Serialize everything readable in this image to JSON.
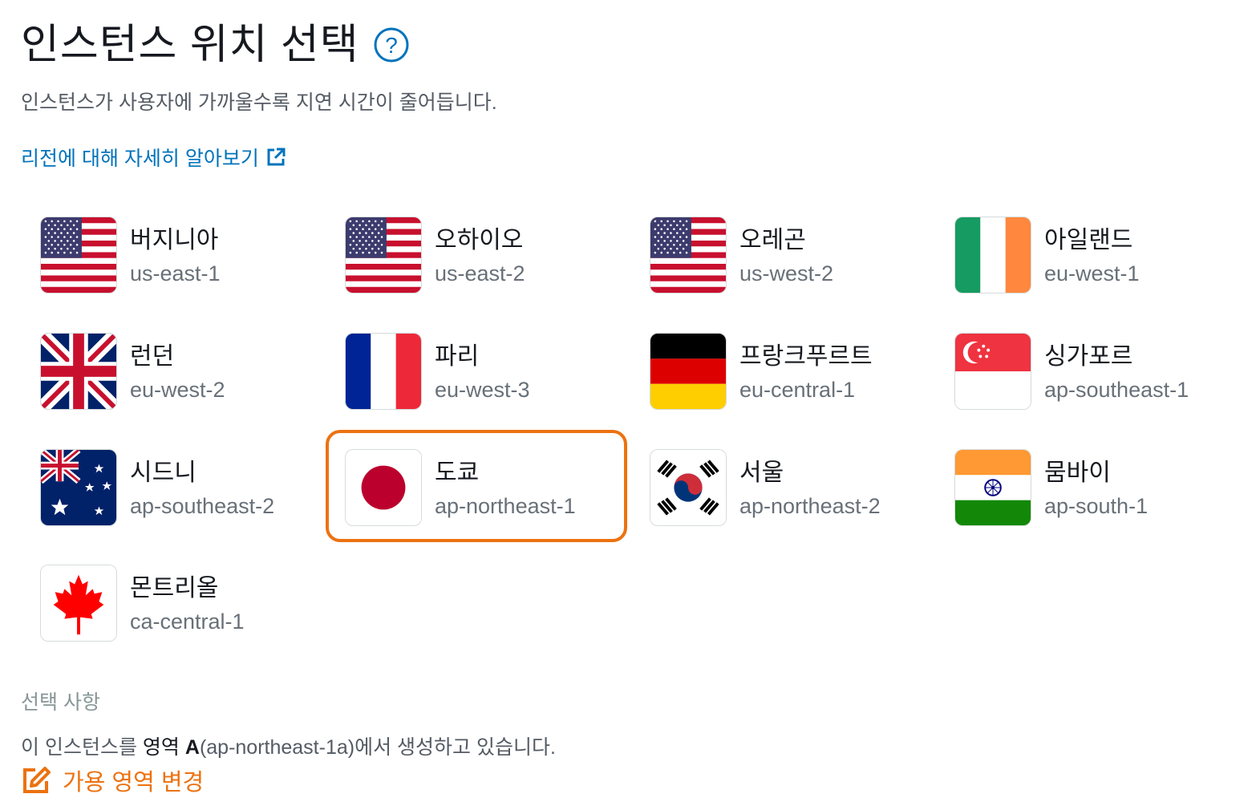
{
  "header": {
    "title": "인스턴스 위치 선택",
    "help_icon": "help-circle-icon",
    "subtitle": "인스턴스가 사용자에 가까울수록 지연 시간이 줄어듭니다.",
    "learn_more_label": "리전에 대해 자세히 알아보기",
    "learn_more_icon": "external-link-icon"
  },
  "regions": [
    {
      "name": "버지니아",
      "code": "us-east-1",
      "flag": "usa-flag"
    },
    {
      "name": "오하이오",
      "code": "us-east-2",
      "flag": "usa-flag"
    },
    {
      "name": "오레곤",
      "code": "us-west-2",
      "flag": "usa-flag"
    },
    {
      "name": "아일랜드",
      "code": "eu-west-1",
      "flag": "ireland-flag"
    },
    {
      "name": "런던",
      "code": "eu-west-2",
      "flag": "uk-flag"
    },
    {
      "name": "파리",
      "code": "eu-west-3",
      "flag": "france-flag"
    },
    {
      "name": "프랑크푸르트",
      "code": "eu-central-1",
      "flag": "germany-flag"
    },
    {
      "name": "싱가포르",
      "code": "ap-southeast-1",
      "flag": "singapore-flag"
    },
    {
      "name": "시드니",
      "code": "ap-southeast-2",
      "flag": "australia-flag"
    },
    {
      "name": "도쿄",
      "code": "ap-northeast-1",
      "flag": "japan-flag",
      "selected": true
    },
    {
      "name": "서울",
      "code": "ap-northeast-2",
      "flag": "korea-flag"
    },
    {
      "name": "뭄바이",
      "code": "ap-south-1",
      "flag": "india-flag"
    },
    {
      "name": "몬트리올",
      "code": "ca-central-1",
      "flag": "canada-flag"
    }
  ],
  "selection": {
    "heading": "선택 사항",
    "text_prefix": "이 인스턴스를 ",
    "zone_word": "영역",
    "zone_letter": "A",
    "text_suffix": "(ap-northeast-1a)에서 생성하고 있습니다.",
    "change_label": "가용 영역 변경",
    "change_icon": "edit-icon"
  },
  "colors": {
    "selected_border": "#ec7211",
    "link": "#0073bb",
    "change_link": "#ec7211"
  }
}
